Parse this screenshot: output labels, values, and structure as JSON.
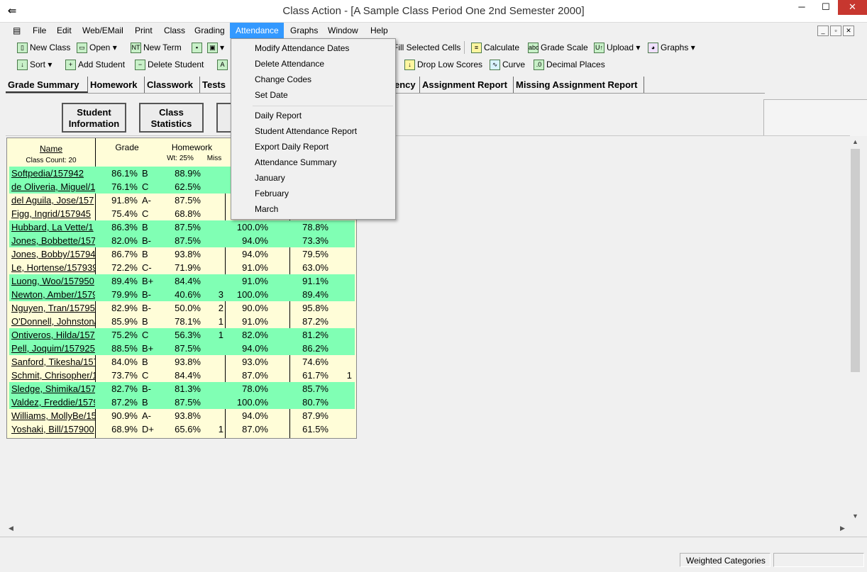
{
  "window": {
    "title": "Class Action - [A Sample Class Period One 2nd Semester 2000]",
    "minimize": "─",
    "restore": "☐",
    "close": "✕",
    "app_icon": "⇚"
  },
  "menu": {
    "doc_icon": "▤",
    "items": [
      "File",
      "Edit",
      "Web/EMail",
      "Print",
      "Class",
      "Grading",
      "Attendance",
      "Graphs",
      "Window",
      "Help"
    ],
    "active": "Attendance"
  },
  "mdi": {
    "minimize": "_",
    "restore": "▫",
    "close": "✕"
  },
  "toolbar1": {
    "new_class": "New Class",
    "open": "Open",
    "new_term": "New Term",
    "fill_selected": "Fill Selected Cells",
    "calculate": "Calculate",
    "grade_scale": "Grade Scale",
    "upload": "Upload",
    "graphs": "Graphs",
    "icon_new": "▯",
    "icon_open": "▭",
    "icon_new_term": "NT",
    "icon_save": "▪",
    "icon_print": "▣",
    "icon_calc": "≡",
    "icon_grade_scale": "abc",
    "icon_upload": "U↑",
    "icon_graphs": "◕",
    "caret": "▾"
  },
  "toolbar2": {
    "sort": "Sort",
    "add_student": "Add Student",
    "delete_student": "Delete Student",
    "drop_low": "Drop Low Scores",
    "curve": "Curve",
    "decimal_places": "Decimal Places",
    "icon_sort": "↓",
    "icon_add": "+",
    "icon_delete": "−",
    "icon_extra": "A",
    "icon_drop": "↓",
    "icon_curve": "∿",
    "icon_decimal": ".0"
  },
  "tabs": [
    "Grade Summary",
    "Homework",
    "Classwork",
    "Tests",
    "ency",
    "Assignment Report",
    "Missing Assignment Report"
  ],
  "buttons": {
    "student_info": [
      "Student",
      "Information"
    ],
    "class_stats": [
      "Class",
      "Statistics"
    ]
  },
  "grid": {
    "name_header": "Name",
    "class_count": "Class Count: 20",
    "grade_header": "Grade",
    "homework_header": "Homework",
    "weight": "Wt: 25%",
    "miss": "Miss",
    "rows": [
      {
        "name": "Softpedia/157942",
        "pct": "86.1%",
        "letter": "B",
        "hw": "88.9%",
        "miss": "",
        "c5": "",
        "c6": "",
        "extra": "",
        "hl": true
      },
      {
        "name": "de Oliveria, Miguel/1",
        "pct": "76.1%",
        "letter": "C",
        "hw": "62.5%",
        "miss": "",
        "c5": "",
        "c6": "",
        "extra": "",
        "hl": true
      },
      {
        "name": "del Aguila, Jose/157",
        "pct": "91.8%",
        "letter": "A-",
        "hw": "87.5%",
        "miss": "",
        "c5": "",
        "c6": "",
        "extra": "",
        "hl": false
      },
      {
        "name": "Figg, Ingrid/157945",
        "pct": "75.4%",
        "letter": "C",
        "hw": "68.8%",
        "miss": "",
        "c5": "",
        "c6": "",
        "extra": "",
        "hl": false
      },
      {
        "name": "Hubbard, La Vette/1",
        "pct": "86.3%",
        "letter": "B",
        "hw": "87.5%",
        "miss": "",
        "c5": "100.0%",
        "c6": "78.8%",
        "extra": "",
        "hl": true
      },
      {
        "name": "Jones, Bobbette/157",
        "pct": "82.0%",
        "letter": "B-",
        "hw": "87.5%",
        "miss": "",
        "c5": "94.0%",
        "c6": "73.3%",
        "extra": "",
        "hl": true
      },
      {
        "name": "Jones, Bobby/15794",
        "pct": "86.7%",
        "letter": "B",
        "hw": "93.8%",
        "miss": "",
        "c5": "94.0%",
        "c6": "79.5%",
        "extra": "",
        "hl": false
      },
      {
        "name": "Le, Hortense/157939",
        "pct": "72.2%",
        "letter": "C-",
        "hw": "71.9%",
        "miss": "",
        "c5": "91.0%",
        "c6": "63.0%",
        "extra": "",
        "hl": false
      },
      {
        "name": "Luong, Woo/157950",
        "pct": "89.4%",
        "letter": "B+",
        "hw": "84.4%",
        "miss": "",
        "c5": "91.0%",
        "c6": "91.1%",
        "extra": "",
        "hl": true
      },
      {
        "name": "Newton, Amber/1579",
        "pct": "79.9%",
        "letter": "B-",
        "hw": "40.6%",
        "miss": "3",
        "c5": "100.0%",
        "c6": "89.4%",
        "extra": "",
        "hl": true
      },
      {
        "name": "Nguyen, Tran/157952",
        "pct": "82.9%",
        "letter": "B-",
        "hw": "50.0%",
        "miss": "2",
        "c5": "90.0%",
        "c6": "95.8%",
        "extra": "",
        "hl": false
      },
      {
        "name": "O'Donnell, Johnston/",
        "pct": "85.9%",
        "letter": "B",
        "hw": "78.1%",
        "miss": "1",
        "c5": "91.0%",
        "c6": "87.2%",
        "extra": "",
        "hl": false
      },
      {
        "name": "Ontiveros, Hilda/1579",
        "pct": "75.2%",
        "letter": "C",
        "hw": "56.3%",
        "miss": "1",
        "c5": "82.0%",
        "c6": "81.2%",
        "extra": "",
        "hl": true
      },
      {
        "name": "Pell, Joquim/157925",
        "pct": "88.5%",
        "letter": "B+",
        "hw": "87.5%",
        "miss": "",
        "c5": "94.0%",
        "c6": "86.2%",
        "extra": "",
        "hl": true
      },
      {
        "name": "Sanford, Tikesha/157",
        "pct": "84.0%",
        "letter": "B",
        "hw": "93.8%",
        "miss": "",
        "c5": "93.0%",
        "c6": "74.6%",
        "extra": "",
        "hl": false
      },
      {
        "name": "Schmit, Chrisopher/1",
        "pct": "73.7%",
        "letter": "C",
        "hw": "84.4%",
        "miss": "",
        "c5": "87.0%",
        "c6": "61.7%",
        "extra": "1",
        "hl": false
      },
      {
        "name": "Sledge, Shimika/157",
        "pct": "82.7%",
        "letter": "B-",
        "hw": "81.3%",
        "miss": "",
        "c5": "78.0%",
        "c6": "85.7%",
        "extra": "",
        "hl": true
      },
      {
        "name": "Valdez, Freddie/1579",
        "pct": "87.2%",
        "letter": "B",
        "hw": "87.5%",
        "miss": "",
        "c5": "100.0%",
        "c6": "80.7%",
        "extra": "",
        "hl": true
      },
      {
        "name": "Williams, MollyBe/15",
        "pct": "90.9%",
        "letter": "A-",
        "hw": "93.8%",
        "miss": "",
        "c5": "94.0%",
        "c6": "87.9%",
        "extra": "",
        "hl": false
      },
      {
        "name": "Yoshaki, Bill/157900",
        "pct": "68.9%",
        "letter": "D+",
        "hw": "65.6%",
        "miss": "1",
        "c5": "87.0%",
        "c6": "61.5%",
        "extra": "",
        "hl": false
      }
    ]
  },
  "attendance_menu": {
    "group1": [
      "Modify Attendance Dates",
      "Delete Attendance",
      "Change Codes",
      "Set Date"
    ],
    "group2": [
      "Daily Report",
      "Student Attendance Report",
      "Export Daily Report",
      "Attendance Summary",
      "January",
      "February",
      "March"
    ]
  },
  "scroll": {
    "up": "▲",
    "down": "▼",
    "left": "◀",
    "right": "▶"
  },
  "status": {
    "weighted": "Weighted Categories"
  },
  "colors": {
    "highlight": "#80ffb4",
    "grid_bg": "#fffdd8",
    "menu_active": "#3399ff",
    "close_btn": "#c7372f"
  }
}
